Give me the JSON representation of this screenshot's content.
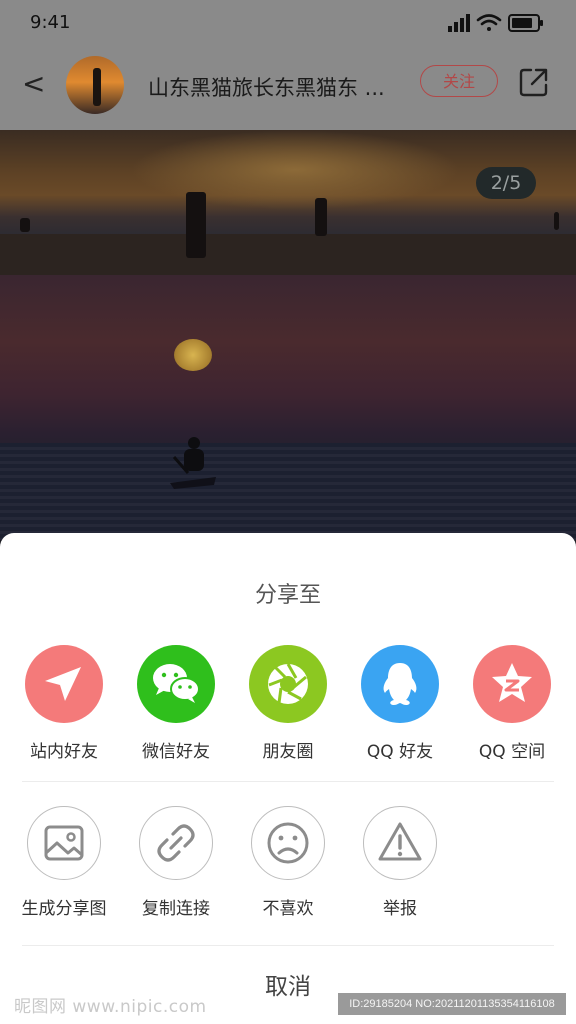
{
  "status": {
    "time": "9:41"
  },
  "header": {
    "back": "<",
    "title": "山东黑猫旅长东黑猫东 ...",
    "follow": "关注"
  },
  "gallery": {
    "counter": "2/5"
  },
  "share_sheet": {
    "title": "分享至",
    "apps": [
      {
        "label": "站内好友",
        "color": "#f47a7a",
        "icon": "paper-plane-icon"
      },
      {
        "label": "微信好友",
        "color": "#2fbf1c",
        "icon": "wechat-icon"
      },
      {
        "label": "朋友圈",
        "color": "#8cc821",
        "icon": "moments-aperture-icon"
      },
      {
        "label": "QQ 好友",
        "color": "#3aa4f2",
        "icon": "qq-penguin-icon"
      },
      {
        "label": "QQ 空间",
        "color": "#f47a7a",
        "icon": "qzone-star-icon"
      }
    ],
    "actions": [
      {
        "label": "生成分享图",
        "icon": "image-icon"
      },
      {
        "label": "复制连接",
        "icon": "link-icon"
      },
      {
        "label": "不喜欢",
        "icon": "sad-face-icon"
      },
      {
        "label": "举报",
        "icon": "warning-icon"
      }
    ],
    "cancel": "取消"
  },
  "watermark": {
    "left": "昵图网 www.nipic.com",
    "right": "ID:29185204 NO:20211201135354116108"
  }
}
